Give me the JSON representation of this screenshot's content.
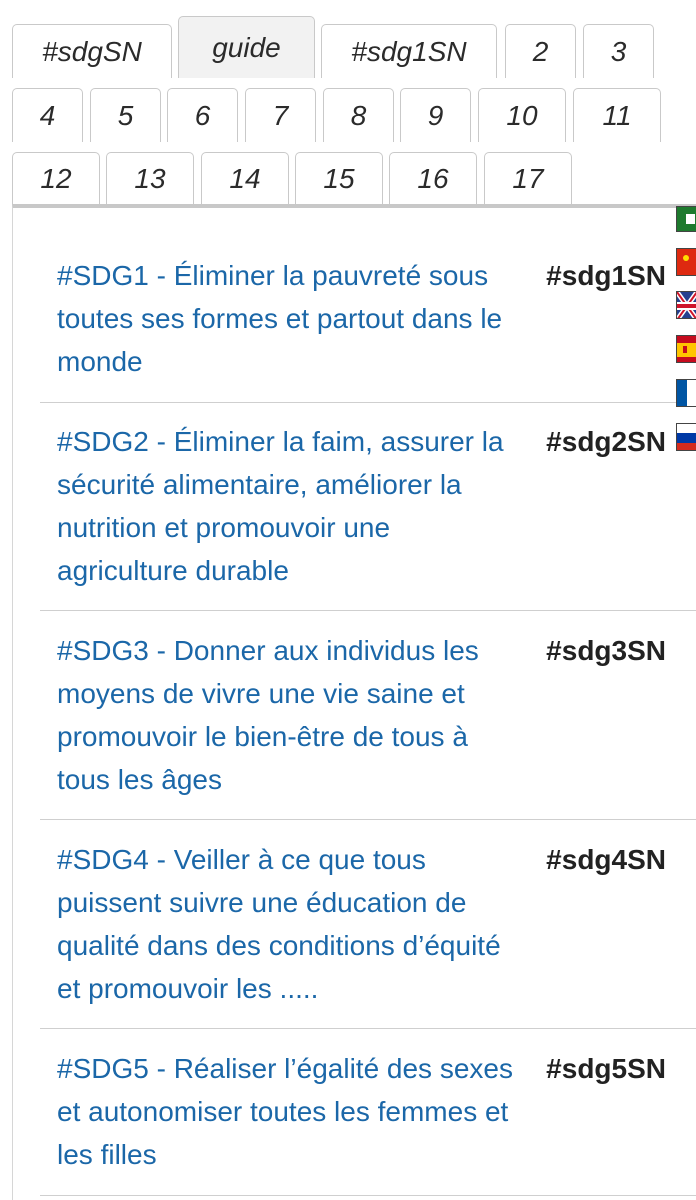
{
  "tabs": [
    {
      "label": "#sdgSN",
      "active": false
    },
    {
      "label": "guide",
      "active": true
    },
    {
      "label": "#sdg1SN",
      "active": false
    },
    {
      "label": "2",
      "active": false
    },
    {
      "label": "3",
      "active": false
    },
    {
      "label": "4",
      "active": false
    },
    {
      "label": "5",
      "active": false
    },
    {
      "label": "6",
      "active": false
    },
    {
      "label": "7",
      "active": false
    },
    {
      "label": "8",
      "active": false
    },
    {
      "label": "9",
      "active": false
    },
    {
      "label": "10",
      "active": false
    },
    {
      "label": "11",
      "active": false
    },
    {
      "label": "12",
      "active": false
    },
    {
      "label": "13",
      "active": false
    },
    {
      "label": "14",
      "active": false
    },
    {
      "label": "15",
      "active": false
    },
    {
      "label": "16",
      "active": false
    },
    {
      "label": "17",
      "active": false
    }
  ],
  "goals": [
    {
      "title": "#SDG1 - Éliminer la pauvreté sous toutes ses formes et partout dans le monde",
      "tag": "#sdg1SN"
    },
    {
      "title": "#SDG2 - Éliminer la faim, assurer la sécurité alimentaire, améliorer la nutrition et promouvoir une agriculture durable",
      "tag": "#sdg2SN"
    },
    {
      "title": "#SDG3 - Donner aux individus les moyens de vivre une vie saine et promouvoir le bien-être de tous à tous les âges",
      "tag": "#sdg3SN"
    },
    {
      "title": "#SDG4 - Veiller à ce que tous puissent suivre une éducation de qualité dans des conditions d’équité et promouvoir les .....",
      "tag": "#sdg4SN"
    },
    {
      "title": "#SDG5 - Réaliser l’égalité des sexes et autonomiser toutes les femmes et les filles",
      "tag": "#sdg5SN"
    }
  ],
  "flags": [
    {
      "icon": "arabic-flag-icon"
    },
    {
      "icon": "chinese-flag-icon"
    },
    {
      "icon": "english-flag-icon"
    },
    {
      "icon": "spanish-flag-icon"
    },
    {
      "icon": "french-flag-icon"
    },
    {
      "icon": "russian-flag-icon"
    }
  ],
  "colors": {
    "link": "#1b67a8",
    "tag": "#222222",
    "tab_active_bg": "#f2f2f2",
    "border": "#c9c9c9"
  }
}
